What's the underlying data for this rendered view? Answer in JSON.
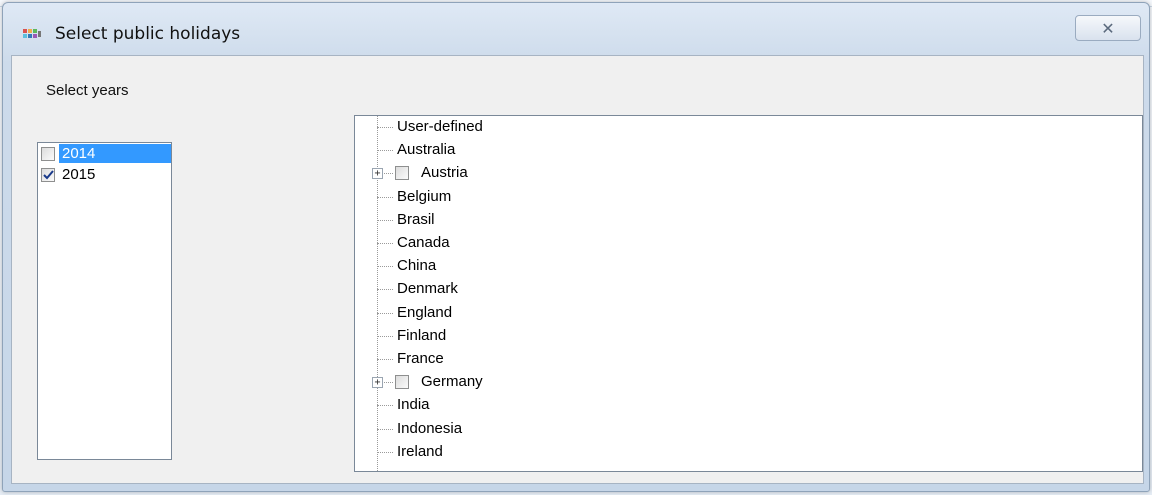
{
  "window": {
    "title": "Select public holidays",
    "close_glyph": "✕"
  },
  "years": {
    "label": "Select years",
    "items": [
      {
        "label": "2014",
        "checked": false,
        "selected": true
      },
      {
        "label": "2015",
        "checked": true,
        "selected": false
      }
    ]
  },
  "tree": {
    "nodes": [
      {
        "label": "User-defined",
        "expandable": false,
        "checkbox": false
      },
      {
        "label": "Australia",
        "expandable": false,
        "checkbox": false
      },
      {
        "label": "Austria",
        "expandable": true,
        "checkbox": true
      },
      {
        "label": "Belgium",
        "expandable": false,
        "checkbox": false
      },
      {
        "label": "Brasil",
        "expandable": false,
        "checkbox": false
      },
      {
        "label": "Canada",
        "expandable": false,
        "checkbox": false
      },
      {
        "label": "China",
        "expandable": false,
        "checkbox": false
      },
      {
        "label": "Denmark",
        "expandable": false,
        "checkbox": false
      },
      {
        "label": "England",
        "expandable": false,
        "checkbox": false
      },
      {
        "label": "Finland",
        "expandable": false,
        "checkbox": false
      },
      {
        "label": "France",
        "expandable": false,
        "checkbox": false
      },
      {
        "label": "Germany",
        "expandable": true,
        "checkbox": true
      },
      {
        "label": "India",
        "expandable": false,
        "checkbox": false
      },
      {
        "label": "Indonesia",
        "expandable": false,
        "checkbox": false
      },
      {
        "label": "Ireland",
        "expandable": false,
        "checkbox": false
      }
    ],
    "expander_glyph": "+"
  },
  "colors": {
    "selection": "#3399ff",
    "window_frame": "#cddbeb"
  }
}
